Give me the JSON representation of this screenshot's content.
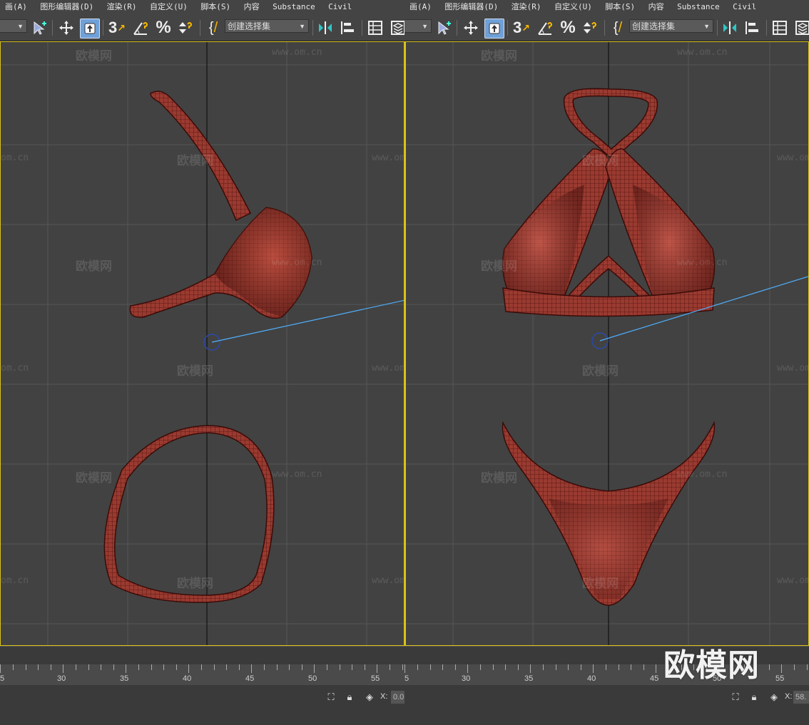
{
  "menu": [
    "画(A)",
    "图形编辑器(D)",
    "渲染(R)",
    "自定义(U)",
    "脚本(S)",
    "内容",
    "Substance",
    "Civil"
  ],
  "menu_right": [
    "画(A)",
    "图形编辑器(D)",
    "渲染(R)",
    "自定义(U)",
    "脚本(S)",
    "内容",
    "Substance",
    "Civil"
  ],
  "toolbar": {
    "snap3_label": "3",
    "percent_label": "%",
    "selection_set": "创建选择集",
    "selection_arrow": "▼"
  },
  "watermark": {
    "cn": "欧模网",
    "url": "www.om.cn",
    "url_short": "om.cn"
  },
  "timeline_ticks": [
    "5",
    "30",
    "35",
    "40",
    "45",
    "50",
    "55"
  ],
  "timeline_ticks_right": [
    "5",
    "30",
    "35",
    "40",
    "45",
    "50",
    "55"
  ],
  "status": {
    "x_label": "X:",
    "x_value_left": "0.0",
    "x_value_right": "58."
  },
  "brand_watermark": "欧模网",
  "colors": {
    "viewport_bg": "#424242",
    "active_border": "#d9c21a",
    "mesh": "#8a2a22",
    "wire": "#4fb0ff"
  }
}
